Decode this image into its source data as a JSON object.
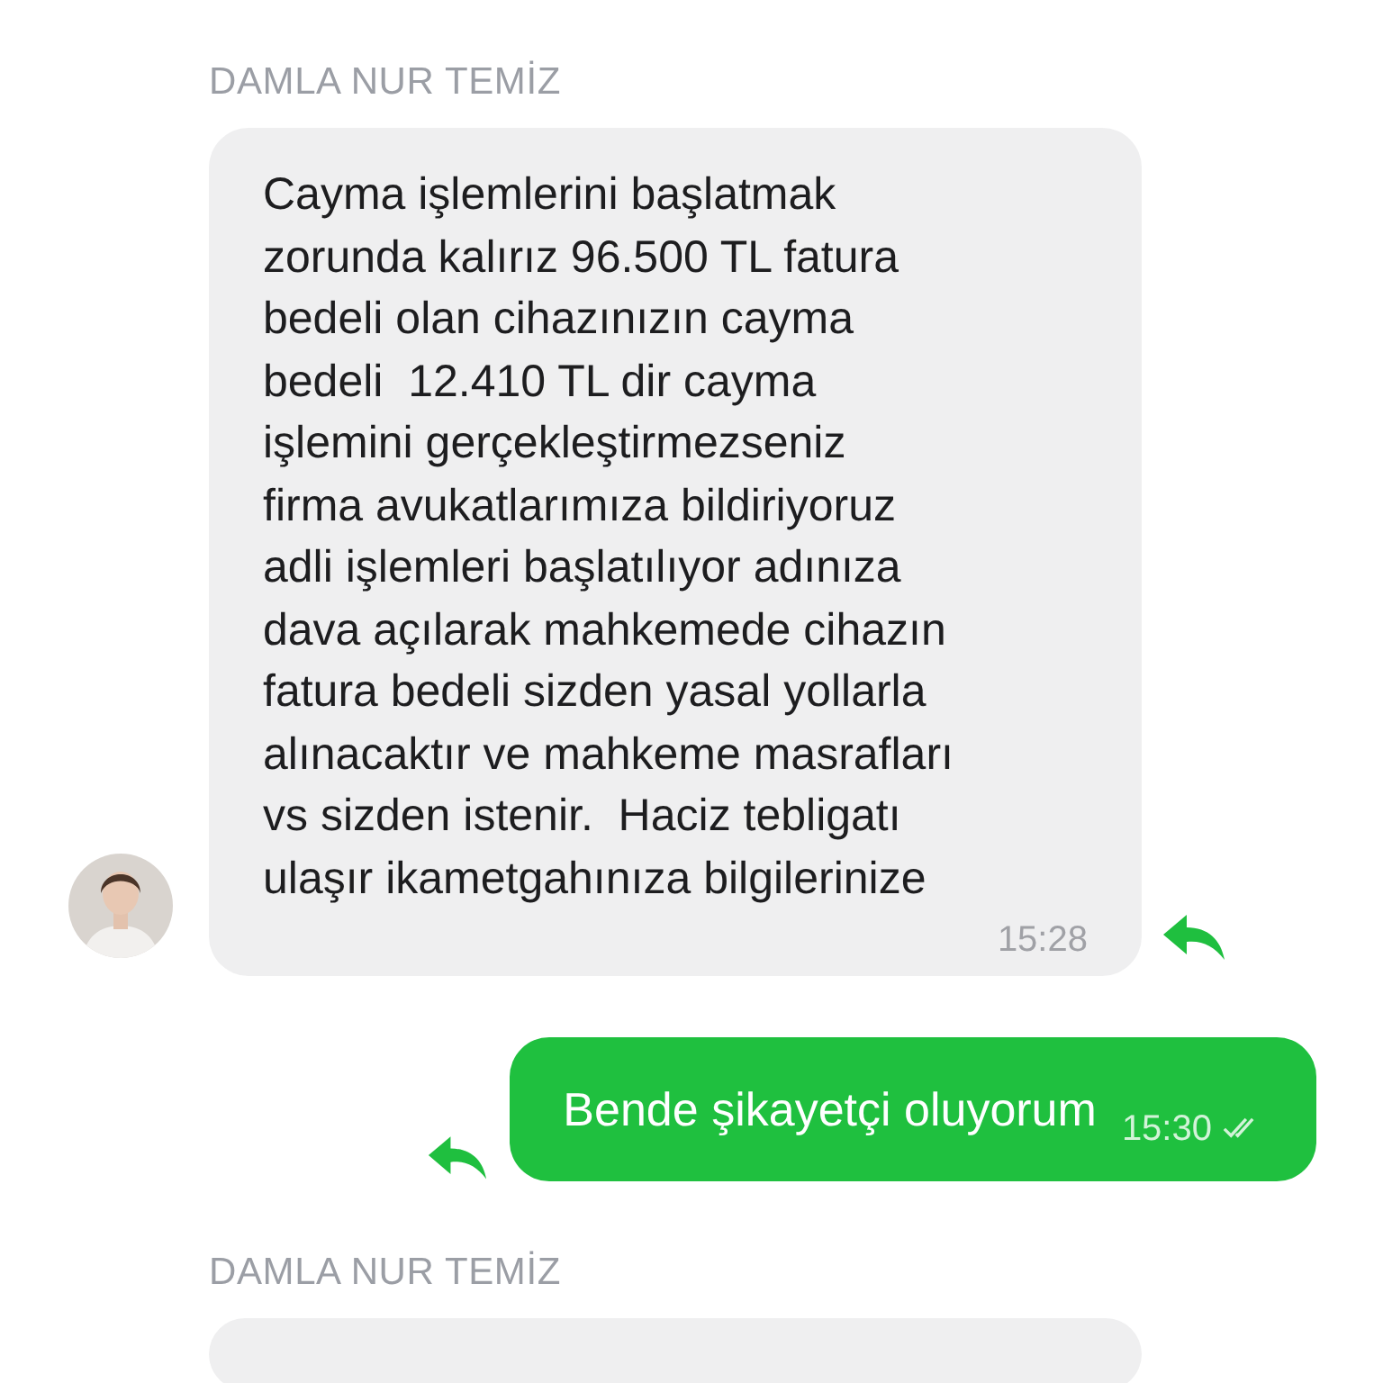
{
  "messages": [
    {
      "kind": "incoming",
      "sender": "DAMLA NUR TEMİZ",
      "avatar": true,
      "text": "Cayma işlemlerini başlatmak\nzorunda kalırız 96.500 TL fatura\nbedeli olan cihazınızın cayma\nbedeli  12.410 TL dir cayma\nişlemini gerçekleştirmezseniz\nfirma avukatlarımıza bildiriyoruz\nadli işlemleri başlatılıyor adınıza\ndava açılarak mahkemede cihazın\nfatura bedeli sizden yasal yollarla\nalınacaktır ve mahkeme masrafları\nvs sizden istenir.  Haciz tebligatı\nulaşır ikametgahınıza bilgilerinize",
      "time": "15:28"
    },
    {
      "kind": "outgoing",
      "text": "Bende şikayetçi oluyorum",
      "time": "15:30",
      "read": true
    },
    {
      "kind": "incoming",
      "sender": "DAMLA NUR TEMİZ"
    }
  ]
}
